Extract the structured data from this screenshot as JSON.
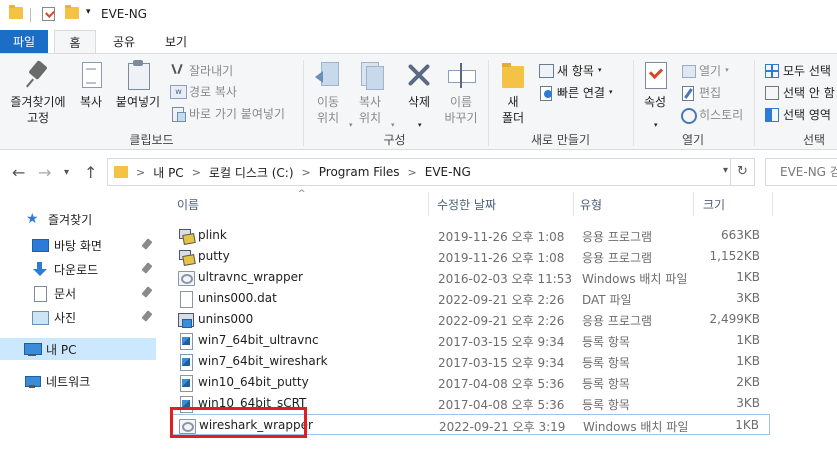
{
  "window": {
    "title": "EVE-NG"
  },
  "ribbon_tabs": {
    "file": "파일",
    "home": "홈",
    "share": "공유",
    "view": "보기"
  },
  "clipboard": {
    "pin": "즐겨찾기에\n고정",
    "copy": "복사",
    "paste": "붙여넣기",
    "cut": "잘라내기",
    "copy_path": "경로 복사",
    "paste_shortcut": "바로 가기 붙여넣기",
    "label": "클립보드"
  },
  "organize": {
    "move_to": "이동\n위치",
    "copy_to": "복사\n위치",
    "delete": "삭제",
    "rename": "이름\n바꾸기",
    "label": "구성"
  },
  "new": {
    "new_folder": "새\n폴더",
    "new_item": "새 항목",
    "easy_access": "빠른 연결",
    "label": "새로 만들기"
  },
  "open": {
    "properties": "속성",
    "open": "열기",
    "edit": "편집",
    "history": "히스토리",
    "label": "열기"
  },
  "select": {
    "select_all": "모두 선택",
    "select_none": "선택 안 함",
    "invert": "선택 영역",
    "label": "선택"
  },
  "address": {
    "crumbs": [
      "내 PC",
      "로컬 디스크 (C:)",
      "Program Files",
      "EVE-NG"
    ],
    "search_placeholder": "EVE-NG 검색"
  },
  "nav": {
    "quick_access": "즐겨찾기",
    "desktop": "바탕 화면",
    "downloads": "다운로드",
    "documents": "문서",
    "pictures": "사진",
    "this_pc": "내 PC",
    "network": "네트워크"
  },
  "columns": {
    "name": "이름",
    "modified": "수정한 날짜",
    "type": "유형",
    "size": "크기"
  },
  "files": [
    {
      "name": "plink",
      "date": "2019-11-26 오후 1:08",
      "type": "응용 프로그램",
      "size": "663KB",
      "icon": "putty-icon"
    },
    {
      "name": "putty",
      "date": "2019-11-26 오후 1:08",
      "type": "응용 프로그램",
      "size": "1,152KB",
      "icon": "putty-icon"
    },
    {
      "name": "ultravnc_wrapper",
      "date": "2016-02-03 오후 11:53",
      "type": "Windows 배치 파일",
      "size": "1KB",
      "icon": "batch-file-icon"
    },
    {
      "name": "unins000.dat",
      "date": "2022-09-21 오후 2:26",
      "type": "DAT 파일",
      "size": "3KB",
      "icon": "dat-file-icon"
    },
    {
      "name": "unins000",
      "date": "2022-09-21 오후 2:26",
      "type": "응용 프로그램",
      "size": "2,499KB",
      "icon": "uninstaller-icon"
    },
    {
      "name": "win7_64bit_ultravnc",
      "date": "2017-03-15 오후 9:34",
      "type": "등록 항목",
      "size": "1KB",
      "icon": "registry-icon"
    },
    {
      "name": "win7_64bit_wireshark",
      "date": "2017-03-15 오후 9:34",
      "type": "등록 항목",
      "size": "1KB",
      "icon": "registry-icon"
    },
    {
      "name": "win10_64bit_putty",
      "date": "2017-04-08 오후 5:36",
      "type": "등록 항목",
      "size": "2KB",
      "icon": "registry-icon"
    },
    {
      "name": "win10_64bit_sCRT",
      "date": "2017-04-08 오후 5:36",
      "type": "등록 항목",
      "size": "3KB",
      "icon": "registry-icon"
    },
    {
      "name": "wireshark_wrapper",
      "date": "2022-09-21 오후 3:19",
      "type": "Windows 배치 파일",
      "size": "1KB",
      "icon": "batch-file-icon"
    }
  ],
  "colors": {
    "accent": "#1a6ec5",
    "highlight_box": "#e02020",
    "selection": "#cce8ff"
  }
}
